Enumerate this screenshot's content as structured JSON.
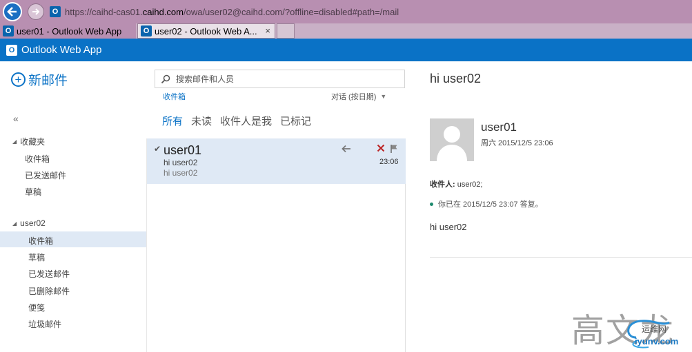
{
  "browser": {
    "url_prefix": "https://caihd-cas01.",
    "url_host": "caihd.com",
    "url_suffix": "/owa/user02@caihd.com/?offline=disabled#path=/mail",
    "tabs": [
      {
        "label": "user01 - Outlook Web App"
      },
      {
        "label": "user02 - Outlook Web A..."
      }
    ],
    "tab_close": "×",
    "favicon": "O"
  },
  "header": {
    "title": "Outlook Web App",
    "logo": "O"
  },
  "nav": {
    "new_mail": "新邮件",
    "collapse": "«",
    "favorites": {
      "label": "收藏夹",
      "items": [
        "收件箱",
        "已发送邮件",
        "草稿"
      ]
    },
    "mailbox": {
      "label": "user02",
      "items": [
        "收件箱",
        "草稿",
        "已发送邮件",
        "已删除邮件",
        "便笺",
        "垃圾邮件"
      ],
      "selected_index": 0
    }
  },
  "list": {
    "search_placeholder": "搜索邮件和人员",
    "folder": "收件箱",
    "sort": "对话 (按日期)",
    "filters": [
      "所有",
      "未读",
      "收件人是我",
      "已标记"
    ],
    "active_filter": 0,
    "messages": [
      {
        "from": "user01",
        "subject": "hi user02",
        "preview": "hi user02",
        "time": "23:06",
        "check": "✔"
      }
    ]
  },
  "reading": {
    "title": "hi user02",
    "sender": "user01",
    "sent_time": "周六 2015/12/5 23:06",
    "to_label": "收件人:",
    "to_value": "user02;",
    "reply_note": "你已在 2015/12/5 23:07 答复。",
    "body": "hi user02"
  },
  "watermark": {
    "text": "高文龙",
    "site_cn": "运维网",
    "site_url": "iyunv.com"
  },
  "colors": {
    "owa_blue": "#0a72c6",
    "chrome_purple": "#b88fb1",
    "selection": "#dfe9f5"
  }
}
